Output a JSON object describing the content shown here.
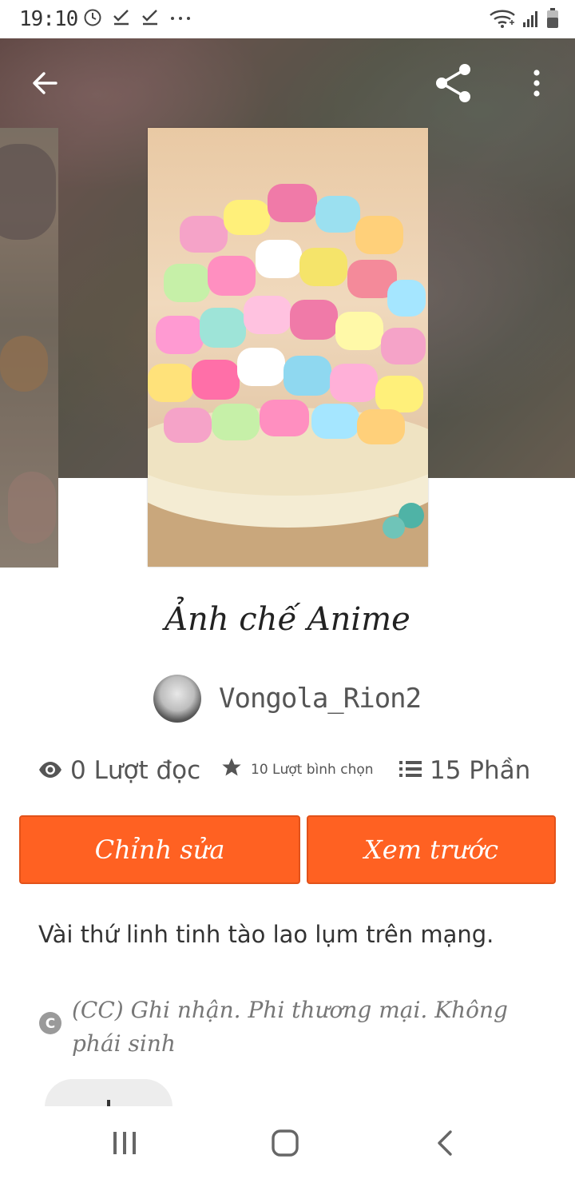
{
  "status_bar": {
    "time": "19:10",
    "left_icons": [
      "alarm-icon",
      "check-download-icon",
      "check-download-icon",
      "more-dots-icon"
    ],
    "right_icons": [
      "wifi-icon",
      "signal-icon",
      "battery-icon"
    ]
  },
  "toolbar": {
    "back_icon": "arrow-left-icon",
    "share_icon": "share-icon",
    "more_icon": "more-vertical-icon"
  },
  "story": {
    "title": "Ảnh chế Anime",
    "author": "Vongola_Rion2",
    "reads": "0 Lượt đọc",
    "votes": "10 Lượt bình chọn",
    "parts": "15 Phần",
    "description": "Vài thứ linh tinh tào lao lụm trên mạng.",
    "license": "(CC) Ghi nhận. Phi thương mại. Không phái sinh"
  },
  "actions": {
    "edit_label": "Chỉnh sửa",
    "preview_label": "Xem trước"
  },
  "colors": {
    "accent": "#ff6122",
    "text": "#222222",
    "muted": "#777777"
  },
  "nav": {
    "recents_icon": "recents-icon",
    "home_icon": "home-icon",
    "back_icon": "back-chevron-icon"
  }
}
